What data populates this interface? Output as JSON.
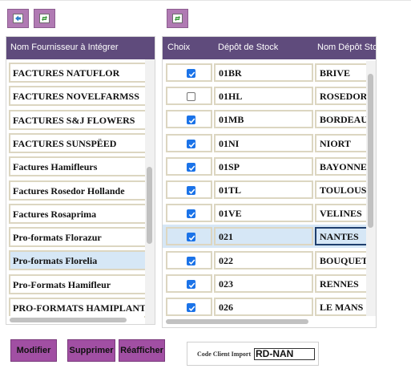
{
  "toolbar": {
    "left_buttons": [
      {
        "icon": "save-icon"
      },
      {
        "icon": "refresh-icon"
      }
    ],
    "right_buttons": [
      {
        "icon": "refresh-icon"
      }
    ]
  },
  "suppliers": {
    "header": "Nom Fournisseur à Intégrer",
    "items": [
      {
        "label": "FACTURES NATUFLOR"
      },
      {
        "label": "FACTURES NOVELFARMSS"
      },
      {
        "label": "FACTURES S&J FLOWERS"
      },
      {
        "label": "FACTURES SUNSPËED"
      },
      {
        "label": "Factures Hamifleurs"
      },
      {
        "label": "Factures Rosedor Hollande"
      },
      {
        "label": "Factures Rosaprima"
      },
      {
        "label": "Pro-formats Florazur"
      },
      {
        "label": "Pro-formats Florelia",
        "selected": true
      },
      {
        "label": "Pro-Formats Hamifleur"
      },
      {
        "label": "PRO-FORMATS HAMIPLANT"
      }
    ]
  },
  "depots": {
    "headers": {
      "choice": "Choix",
      "depot": "Dépôt de Stock",
      "name": "Nom Dépôt Sto"
    },
    "rows": [
      {
        "checked": true,
        "code": "01BR",
        "name": "BRIVE"
      },
      {
        "checked": false,
        "code": "01HL",
        "name": "ROSEDOR"
      },
      {
        "checked": true,
        "code": "01MB",
        "name": "BORDEAUX"
      },
      {
        "checked": true,
        "code": "01NI",
        "name": "NIORT"
      },
      {
        "checked": true,
        "code": "01SP",
        "name": "BAYONNE"
      },
      {
        "checked": true,
        "code": "01TL",
        "name": "TOULOUSE"
      },
      {
        "checked": true,
        "code": "01VE",
        "name": "VELINES"
      },
      {
        "checked": true,
        "code": "021",
        "name": "NANTES",
        "selected": true
      },
      {
        "checked": true,
        "code": "022",
        "name": "BOUQUET"
      },
      {
        "checked": true,
        "code": "023",
        "name": "RENNES"
      },
      {
        "checked": true,
        "code": "026",
        "name": "LE MANS"
      }
    ]
  },
  "actions": {
    "modify": "Modifier",
    "delete": "Supprimer",
    "redisplay": "Réafficher"
  },
  "client_code": {
    "label": "Code Client Import",
    "value": "RD-NAN"
  },
  "colors": {
    "button_purple": "#a14fa3",
    "header_purple": "#5f4b7c",
    "selection_blue": "#d6e7f6",
    "checkbox_blue": "#1b73e8"
  }
}
